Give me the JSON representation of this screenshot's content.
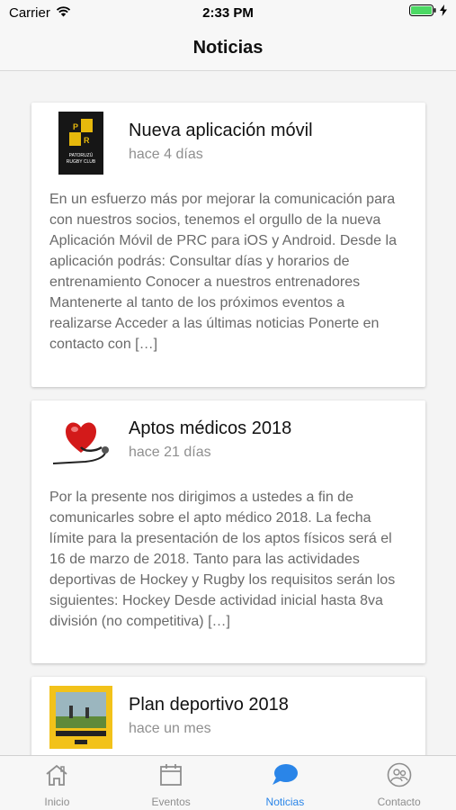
{
  "status_bar": {
    "carrier": "Carrier",
    "time": "2:33 PM"
  },
  "header": {
    "title": "Noticias"
  },
  "news": [
    {
      "title": "Nueva aplicación móvil",
      "date": "hace 4 días",
      "body": "En un esfuerzo más por mejorar la comunicación para con nuestros socios, tenemos el orgullo de la nueva Aplicación Móvil de PRC para iOS y Android. Desde la aplicación podrás: Consultar días y horarios de entrenamiento Conocer a nuestros entrenadores Mantenerte al tanto de los próximos eventos a realizarse Acceder a las últimas noticias Ponerte en contacto con […]",
      "thumb_text": [
        "PATORUZÚ",
        "RUGBY CLUB"
      ]
    },
    {
      "title": "Aptos médicos 2018",
      "date": "hace 21 días",
      "body": "Por la presente nos dirigimos a ustedes a fin de comunicarles sobre el apto médico 2018. La fecha límite para la presentación de los aptos físicos será el 16 de marzo de 2018. Tanto para las actividades deportivas de Hockey y Rugby los requisitos serán los siguientes: Hockey Desde actividad inicial hasta 8va división (no competitiva) […]"
    },
    {
      "title": "Plan deportivo 2018",
      "date": "hace un mes",
      "body": ""
    }
  ],
  "tabs": [
    {
      "label": "Inicio",
      "icon": "home-icon"
    },
    {
      "label": "Eventos",
      "icon": "calendar-icon"
    },
    {
      "label": "Noticias",
      "icon": "chat-bubble-icon"
    },
    {
      "label": "Contacto",
      "icon": "contact-icon"
    }
  ],
  "colors": {
    "active_tab": "#2a85e8",
    "inactive_tab": "#8e8e8e",
    "battery": "#4cd964"
  }
}
